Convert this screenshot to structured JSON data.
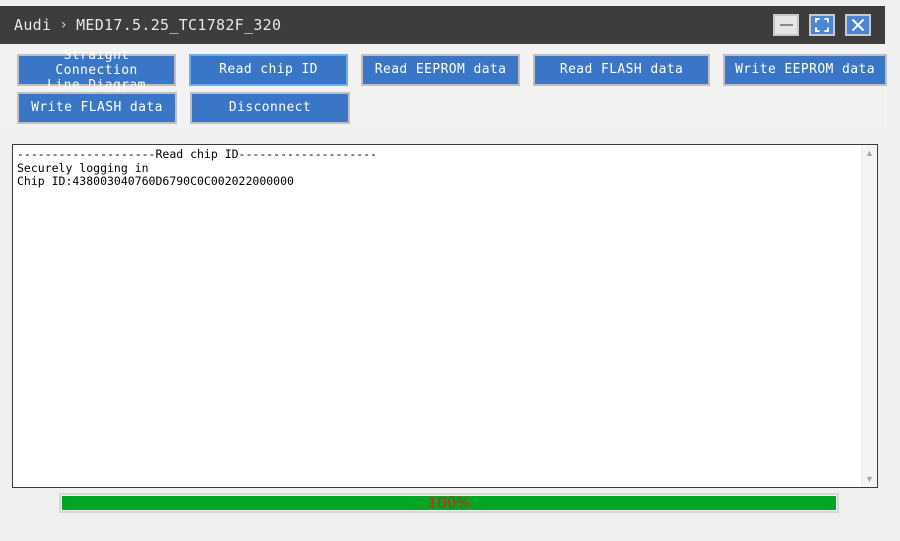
{
  "window": {
    "breadcrumb": {
      "root": "Audi",
      "separator": "›",
      "current": "MED17.5.25_TC1782F_320"
    },
    "controls": {
      "minimize": "minimize-icon",
      "maximize": "maximize-icon",
      "close": "close-icon"
    }
  },
  "toolbar": {
    "row1": [
      {
        "label": "Straight Connection\nLine Diagram",
        "name": "straight-connection-line-diagram-button",
        "focused": false
      },
      {
        "label": "Read chip ID",
        "name": "read-chip-id-button",
        "focused": true
      },
      {
        "label": "Read EEPROM data",
        "name": "read-eeprom-data-button",
        "focused": false
      },
      {
        "label": "Read FLASH data",
        "name": "read-flash-data-button",
        "focused": false
      },
      {
        "label": "Write EEPROM data",
        "name": "write-eeprom-data-button",
        "focused": false
      }
    ],
    "row2": [
      {
        "label": "Write FLASH data",
        "name": "write-flash-data-button",
        "focused": false
      },
      {
        "label": "Disconnect",
        "name": "disconnect-button",
        "focused": false
      }
    ]
  },
  "log": {
    "lines": [
      "--------------------Read chip ID--------------------",
      "Securely logging in",
      "Chip ID:438003040760D6790C0C002022000000"
    ],
    "text": "--------------------Read chip ID--------------------\nSecurely logging in\nChip ID:438003040760D6790C0C002022000000",
    "scroll_up_glyph": "▲",
    "scroll_down_glyph": "▼"
  },
  "progress": {
    "label": "100%",
    "percent": 100,
    "fill_color": "#00a524",
    "label_color": "#e01b1b"
  }
}
